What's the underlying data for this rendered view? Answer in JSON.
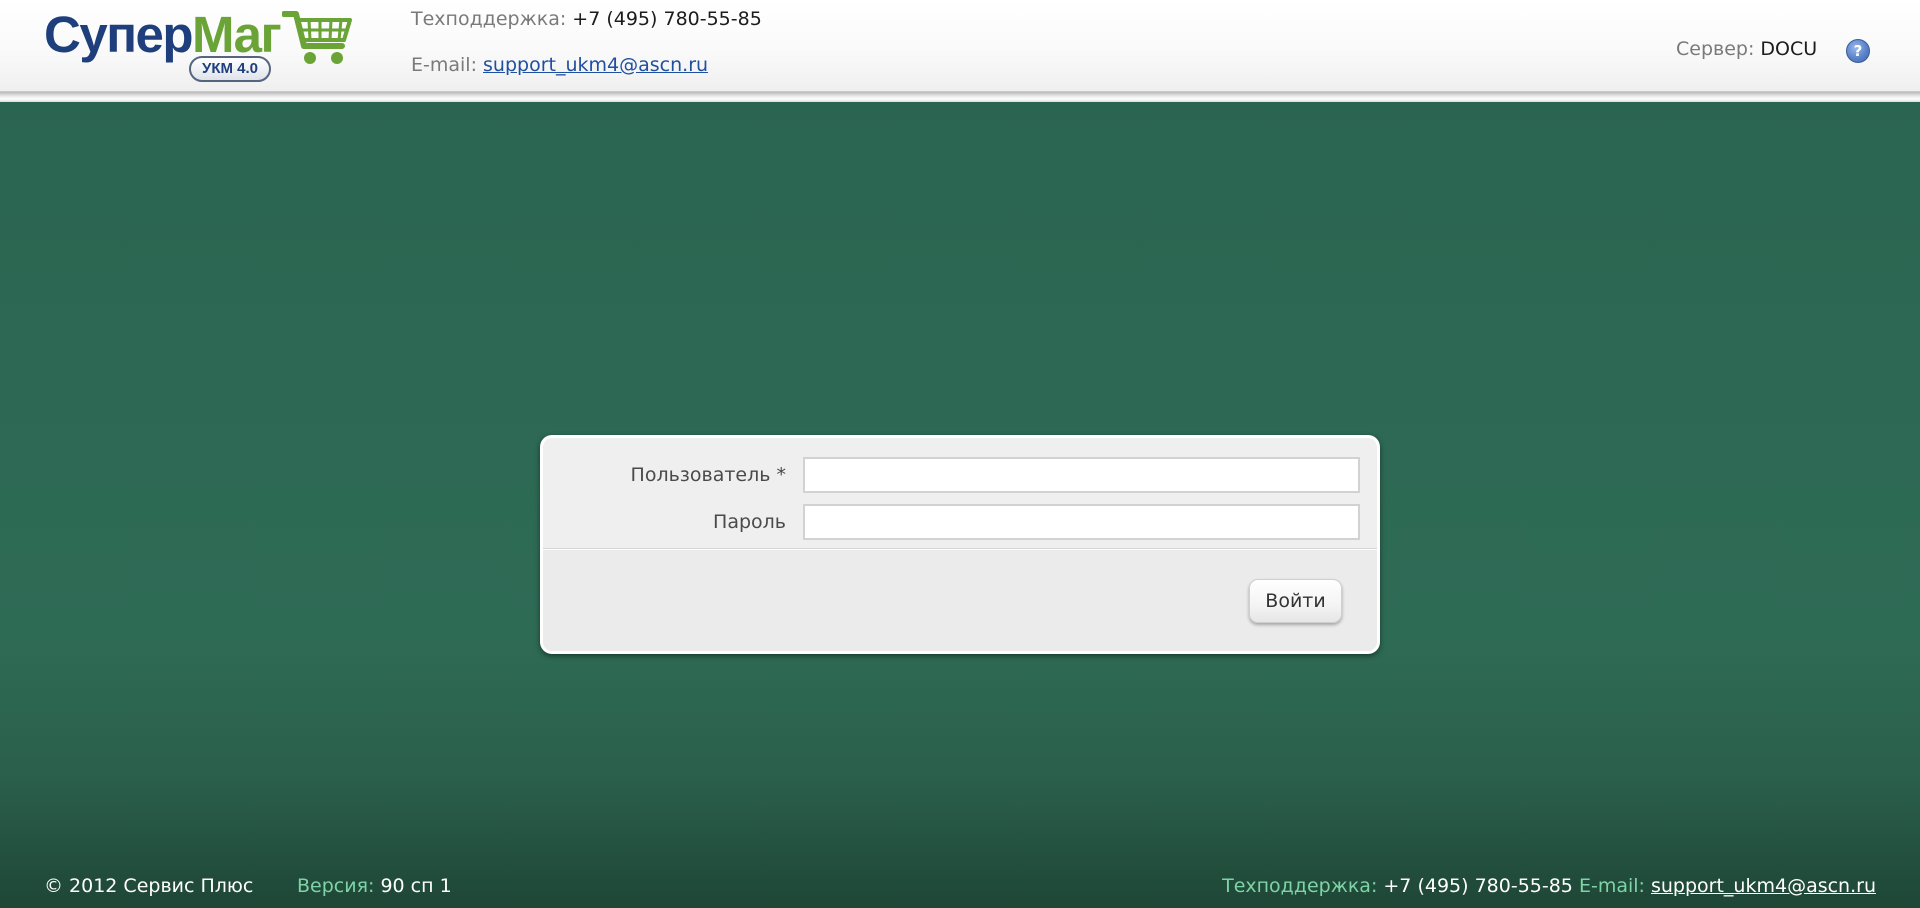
{
  "header": {
    "logo": {
      "word_part1": "Супер",
      "word_part2": "Маг",
      "badge": "УКМ 4.0",
      "colors": {
        "blue": "#1e3f7c",
        "green": "#6aa336"
      }
    },
    "support": {
      "phone_label": "Техподдержка:",
      "phone": "+7 (495) 780-55-85",
      "email_label": "E-mail:",
      "email": "support_ukm4@ascn.ru"
    },
    "server": {
      "label": "Сервер:",
      "value": "DOCU"
    },
    "help_icon": {
      "icon": "help-icon",
      "glyph": "?"
    }
  },
  "login": {
    "user_label": "Пользователь *",
    "user_value": "",
    "password_label": "Пароль",
    "password_value": "",
    "submit_label": "Войти"
  },
  "footer": {
    "copyright": "© 2012 Сервис Плюс",
    "version_label": "Версия:",
    "version_value": "90 сп 1",
    "support_label": "Техподдержка:",
    "support_phone": "+7 (495) 780-55-85",
    "email_label": "E-mail:",
    "email": "support_ukm4@ascn.ru"
  },
  "theme": {
    "background": "#2e6b55",
    "footer_accent": "#7fd3a6"
  }
}
